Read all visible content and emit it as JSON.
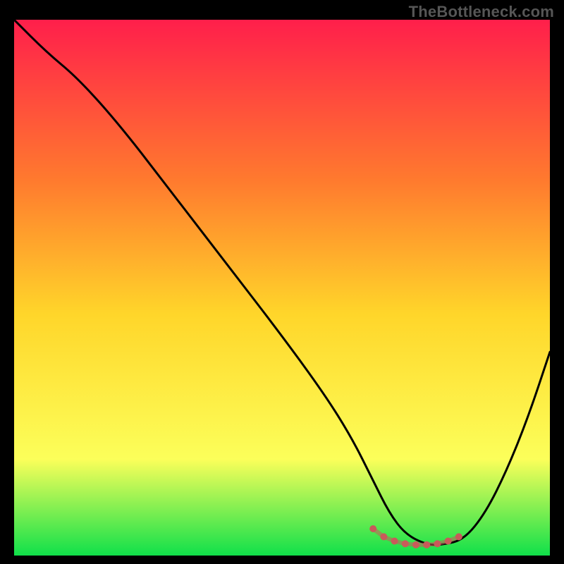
{
  "watermark": "TheBottleneck.com",
  "colors": {
    "background": "#000000",
    "gradient_top": "#ff1f4b",
    "gradient_mid_upper": "#ff7a2e",
    "gradient_mid": "#ffd62a",
    "gradient_mid_lower": "#fcff5a",
    "gradient_bottom": "#10e04a",
    "curve": "#000000",
    "marker": "#c85a5a"
  },
  "chart_data": {
    "type": "line",
    "title": "",
    "xlabel": "",
    "ylabel": "",
    "x_range": [
      0,
      100
    ],
    "y_range": [
      0,
      100
    ],
    "series": [
      {
        "name": "bottleneck-curve",
        "x": [
          0,
          6,
          12,
          20,
          30,
          40,
          50,
          58,
          63,
          67,
          70,
          73,
          77,
          80,
          84,
          88,
          92,
          96,
          100
        ],
        "y": [
          100,
          94,
          89,
          80,
          67,
          54,
          41,
          30,
          22,
          14,
          8,
          4,
          2,
          2,
          3,
          8,
          16,
          26,
          38
        ]
      }
    ],
    "markers": {
      "name": "optimal-region",
      "x": [
        67,
        69,
        71,
        73,
        75,
        77,
        79,
        81,
        83
      ],
      "y": [
        5.0,
        3.5,
        2.7,
        2.2,
        2.0,
        2.0,
        2.2,
        2.7,
        3.5
      ]
    }
  }
}
